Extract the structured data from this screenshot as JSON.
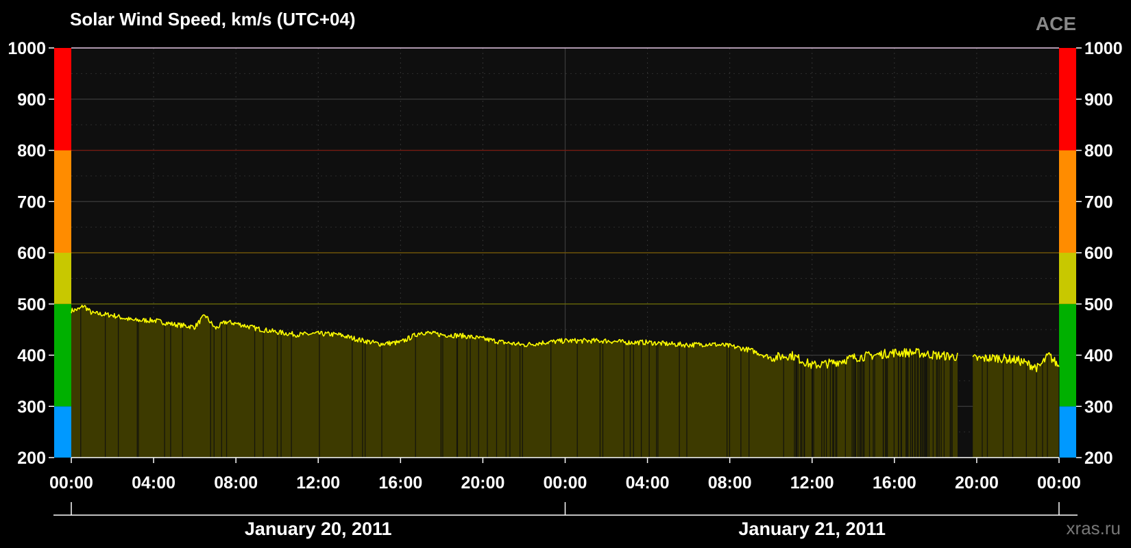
{
  "chart_data": {
    "type": "area",
    "title": "Solar Wind Speed, km/s (UTC+04)",
    "source_label": "ACE",
    "watermark": "xras.ru",
    "ylim": [
      200,
      1000
    ],
    "yticks": [
      "200",
      "300",
      "400",
      "500",
      "600",
      "700",
      "800",
      "900",
      "1000"
    ],
    "xlim_hours": [
      0,
      48
    ],
    "xticks": [
      "00:00",
      "04:00",
      "08:00",
      "12:00",
      "16:00",
      "20:00",
      "00:00",
      "04:00",
      "08:00",
      "12:00",
      "16:00",
      "20:00",
      "00:00"
    ],
    "dates": [
      "January 20, 2011",
      "January 21, 2011"
    ],
    "grid": true,
    "thresholds": [
      {
        "from": 200,
        "to": 300,
        "color": "#0099ff"
      },
      {
        "from": 300,
        "to": 500,
        "color": "#00b000"
      },
      {
        "from": 500,
        "to": 600,
        "color": "#c8c800"
      },
      {
        "from": 600,
        "to": 800,
        "color": "#ff8c00"
      },
      {
        "from": 800,
        "to": 1000,
        "color": "#ff0000"
      }
    ],
    "threshold_lines": [
      {
        "value": 500,
        "color": "#6b6b00"
      },
      {
        "value": 600,
        "color": "#7a5a00"
      },
      {
        "value": 800,
        "color": "#7a1a10"
      }
    ],
    "series": [
      {
        "color": "#ffff00",
        "fill": "#3d3a00",
        "x_hours": [
          0,
          0.4,
          0.6,
          1,
          2,
          3,
          4,
          5,
          6,
          6.5,
          7,
          7.5,
          8,
          9,
          10,
          11,
          12,
          13,
          14,
          15,
          16,
          17,
          18,
          19,
          20,
          21,
          22,
          23,
          24,
          25,
          26,
          27,
          28,
          29,
          30,
          31,
          32,
          33,
          34,
          35,
          36,
          37,
          38,
          39,
          40,
          41,
          42,
          43,
          44,
          45,
          46,
          47,
          47.5,
          48
        ],
        "values": [
          487,
          490,
          497,
          482,
          478,
          468,
          468,
          460,
          455,
          478,
          452,
          465,
          462,
          452,
          445,
          440,
          442,
          440,
          430,
          422,
          425,
          445,
          440,
          438,
          432,
          425,
          420,
          425,
          428,
          428,
          428,
          425,
          425,
          422,
          420,
          422,
          418,
          410,
          395,
          400,
          380,
          385,
          395,
          400,
          405,
          405,
          400,
          397,
          393,
          395,
          390,
          375,
          400,
          378
        ]
      }
    ],
    "gaps_hours": [
      [
        43.1,
        43.8
      ]
    ]
  }
}
